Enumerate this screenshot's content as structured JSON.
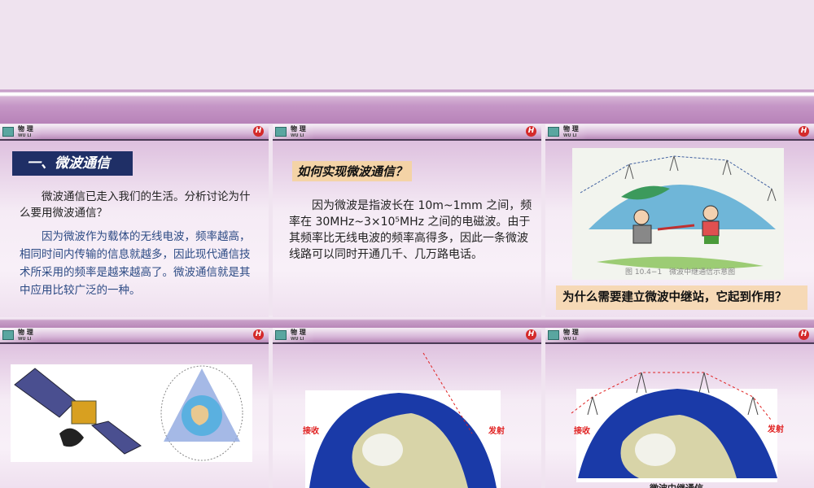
{
  "header": {
    "subject": "物 理",
    "subject_sub": "WU LI",
    "brand_letter": "H"
  },
  "slides": [
    {
      "title": "一、微波通信",
      "question": "　　微波通信已走入我们的生活。分析讨论为什么要用微波通信？",
      "answer": "　　因为微波作为载体的无线电波，频率越高，相同时间内传输的信息就越多，因此现代通信技术所采用的频率是越来越高了。微波通信就是其中应用比较广泛的一种。"
    },
    {
      "label": "如何实现微波通信？",
      "body": "　　因为微波是指波长在 10m~1mm 之间，频率在 30MHz~3×10⁵MHz 之间的电磁波。由于其频率比无线电波的频率高得多，因此一条微波线路可以同时开通几千、几万路电话。"
    },
    {
      "figure_caption": "图 10.4−1　微波中继通信示意图",
      "question": "为什么需要建立微波中继站，它起到作用？"
    },
    {
      "image": "satellite-and-globe"
    },
    {
      "receive": "接收",
      "transmit": "发射"
    },
    {
      "receive": "接收",
      "transmit": "发射",
      "caption": "微波中继通信"
    }
  ]
}
